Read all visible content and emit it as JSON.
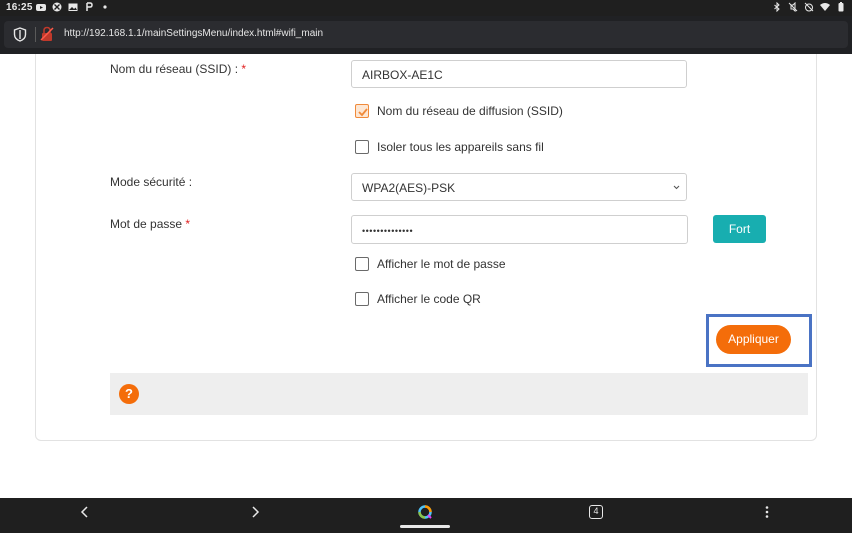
{
  "status_bar": {
    "time": "16:25",
    "left_icons": [
      "youtube-icon",
      "xbox-icon",
      "image-icon",
      "parking-icon",
      "dot-icon"
    ],
    "right_icons": [
      "bluetooth-icon",
      "mute-icon",
      "alarm-off-icon",
      "wifi-icon",
      "battery-icon"
    ]
  },
  "browser": {
    "url": "http://192.168.1.1/mainSettingsMenu/index.html#wifi_main"
  },
  "form": {
    "ssid": {
      "label": "Nom du réseau (SSID) :",
      "required_mark": "*",
      "value": "AIRBOX-AE1C"
    },
    "broadcast_ssid": {
      "label": "Nom du réseau de diffusion (SSID)",
      "checked": true
    },
    "isolate": {
      "label": "Isoler tous les appareils sans fil",
      "checked": false
    },
    "security": {
      "label": "Mode sécurité :",
      "value": "WPA2(AES)-PSK"
    },
    "password": {
      "label": "Mot de passe",
      "required_mark": "*",
      "value": "••••••••••••••",
      "strength": "Fort"
    },
    "show_password": {
      "label": "Afficher le mot de passe",
      "checked": false
    },
    "show_qr": {
      "label": "Afficher le code QR",
      "checked": false
    },
    "apply_label": "Appliquer",
    "help_symbol": "?"
  },
  "nav_bar": {
    "tab_count": "4"
  },
  "colors": {
    "accent_orange": "#f46d0a",
    "teal": "#18aeb0",
    "highlight_blue": "#4a73c4"
  }
}
